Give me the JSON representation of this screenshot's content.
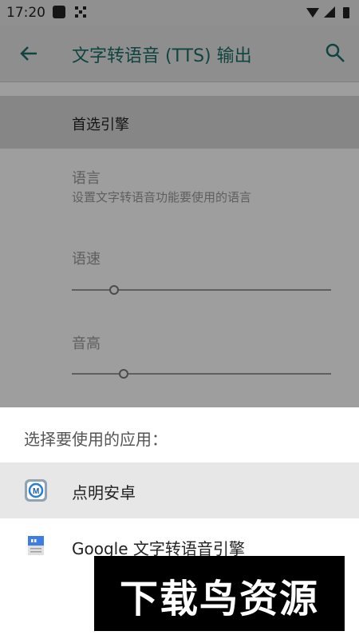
{
  "status_bar": {
    "time": "17:20"
  },
  "toolbar": {
    "title": "文字转语音 (TTS) 输出"
  },
  "preferences": {
    "engine_label": "首选引擎",
    "language_title": "语言",
    "language_summary": "设置文字转语音功能要使用的语言",
    "speech_rate_title": "语速",
    "speech_rate_level": 0.15,
    "pitch_title": "音高",
    "pitch_level": 0.19
  },
  "chooser": {
    "title": "选择要使用的应用：",
    "options": [
      {
        "label": "点明安卓",
        "highlighted": true,
        "icon": "dianming-app-icon"
      },
      {
        "label": "Google 文字转语音引擎",
        "highlighted": false,
        "icon": "google-tts-icon"
      }
    ]
  },
  "watermark": {
    "text": "下载鸟资源"
  },
  "colors": {
    "accent": "#1b6f69",
    "scrim": "rgba(0,0,0,0.38)"
  }
}
